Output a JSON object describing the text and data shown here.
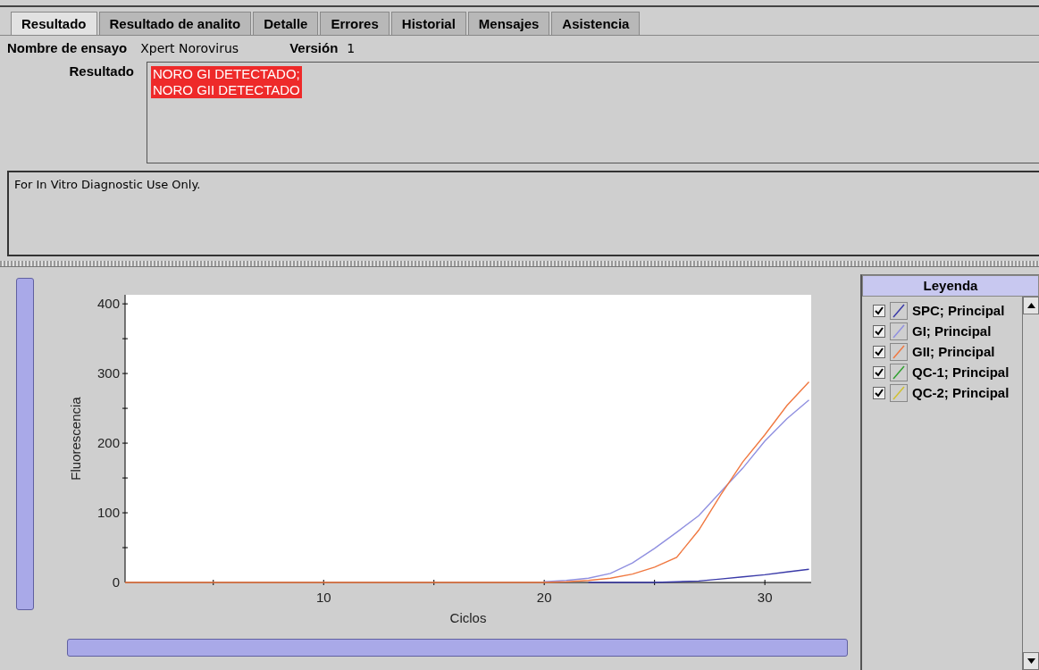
{
  "tabs": [
    {
      "label": "Resultado",
      "selected": true
    },
    {
      "label": "Resultado de analito",
      "selected": false
    },
    {
      "label": "Detalle",
      "selected": false
    },
    {
      "label": "Errores",
      "selected": false
    },
    {
      "label": "Historial",
      "selected": false
    },
    {
      "label": "Mensajes",
      "selected": false
    },
    {
      "label": "Asistencia",
      "selected": false
    }
  ],
  "assay": {
    "name_label": "Nombre de ensayo",
    "name_value": "Xpert Norovirus",
    "version_label": "Versión",
    "version_value": "1"
  },
  "result": {
    "label": "Resultado",
    "lines": [
      "NORO GI DETECTADO;",
      "NORO GII DETECTADO"
    ]
  },
  "note": "For In Vitro Diagnostic Use Only.",
  "chart": {
    "chart_data": {
      "type": "line",
      "xlabel": "Ciclos",
      "ylabel": "Fluorescencia",
      "xlim": [
        1,
        32.1
      ],
      "ylim": [
        0,
        413
      ],
      "xticks": [
        10,
        20,
        30
      ],
      "yticks": [
        0,
        100,
        200,
        300,
        400
      ],
      "x": [
        1,
        2,
        3,
        4,
        5,
        6,
        7,
        8,
        9,
        10,
        11,
        12,
        13,
        14,
        15,
        16,
        17,
        18,
        19,
        20,
        21,
        22,
        23,
        24,
        25,
        26,
        27,
        28,
        29,
        30,
        31,
        32
      ],
      "series": [
        {
          "name": "SPC; Principal",
          "color": "#3a3aa8",
          "values": [
            null,
            null,
            null,
            null,
            null,
            null,
            null,
            null,
            null,
            null,
            null,
            null,
            null,
            null,
            null,
            null,
            null,
            null,
            null,
            null,
            null,
            0,
            0,
            0,
            0,
            1,
            2,
            5,
            8,
            11,
            15,
            19
          ]
        },
        {
          "name": "GI; Principal",
          "color": "#9090e0",
          "values": [
            null,
            null,
            null,
            null,
            null,
            null,
            null,
            null,
            null,
            null,
            null,
            null,
            null,
            null,
            null,
            null,
            null,
            null,
            null,
            1,
            3,
            6,
            13,
            28,
            49,
            72,
            96,
            130,
            164,
            203,
            235,
            262
          ]
        },
        {
          "name": "GII; Principal",
          "color": "#f07840",
          "values": [
            0,
            0,
            0,
            0,
            0,
            0,
            0,
            0,
            0,
            0,
            0,
            0,
            0,
            0,
            0,
            0,
            0,
            0,
            0,
            0,
            1,
            3,
            6,
            12,
            22,
            36,
            75,
            126,
            173,
            212,
            254,
            288
          ]
        },
        {
          "name": "QC-1; Principal",
          "color": "#30a030",
          "values": [
            null,
            null,
            null,
            null,
            null,
            null,
            null,
            null,
            null,
            null,
            null,
            null,
            null,
            null,
            null,
            null,
            null,
            null,
            null,
            null,
            null,
            null,
            null,
            null,
            null,
            null,
            null,
            null,
            null,
            null,
            null,
            null
          ]
        },
        {
          "name": "QC-2; Principal",
          "color": "#d0c030",
          "values": [
            null,
            null,
            null,
            null,
            null,
            null,
            null,
            null,
            null,
            null,
            null,
            null,
            null,
            null,
            null,
            null,
            null,
            null,
            null,
            null,
            null,
            null,
            null,
            null,
            null,
            null,
            null,
            null,
            null,
            null,
            null,
            null
          ]
        }
      ]
    }
  },
  "legend": {
    "title": "Leyenda",
    "checked": [
      true,
      true,
      true,
      true,
      true
    ]
  }
}
